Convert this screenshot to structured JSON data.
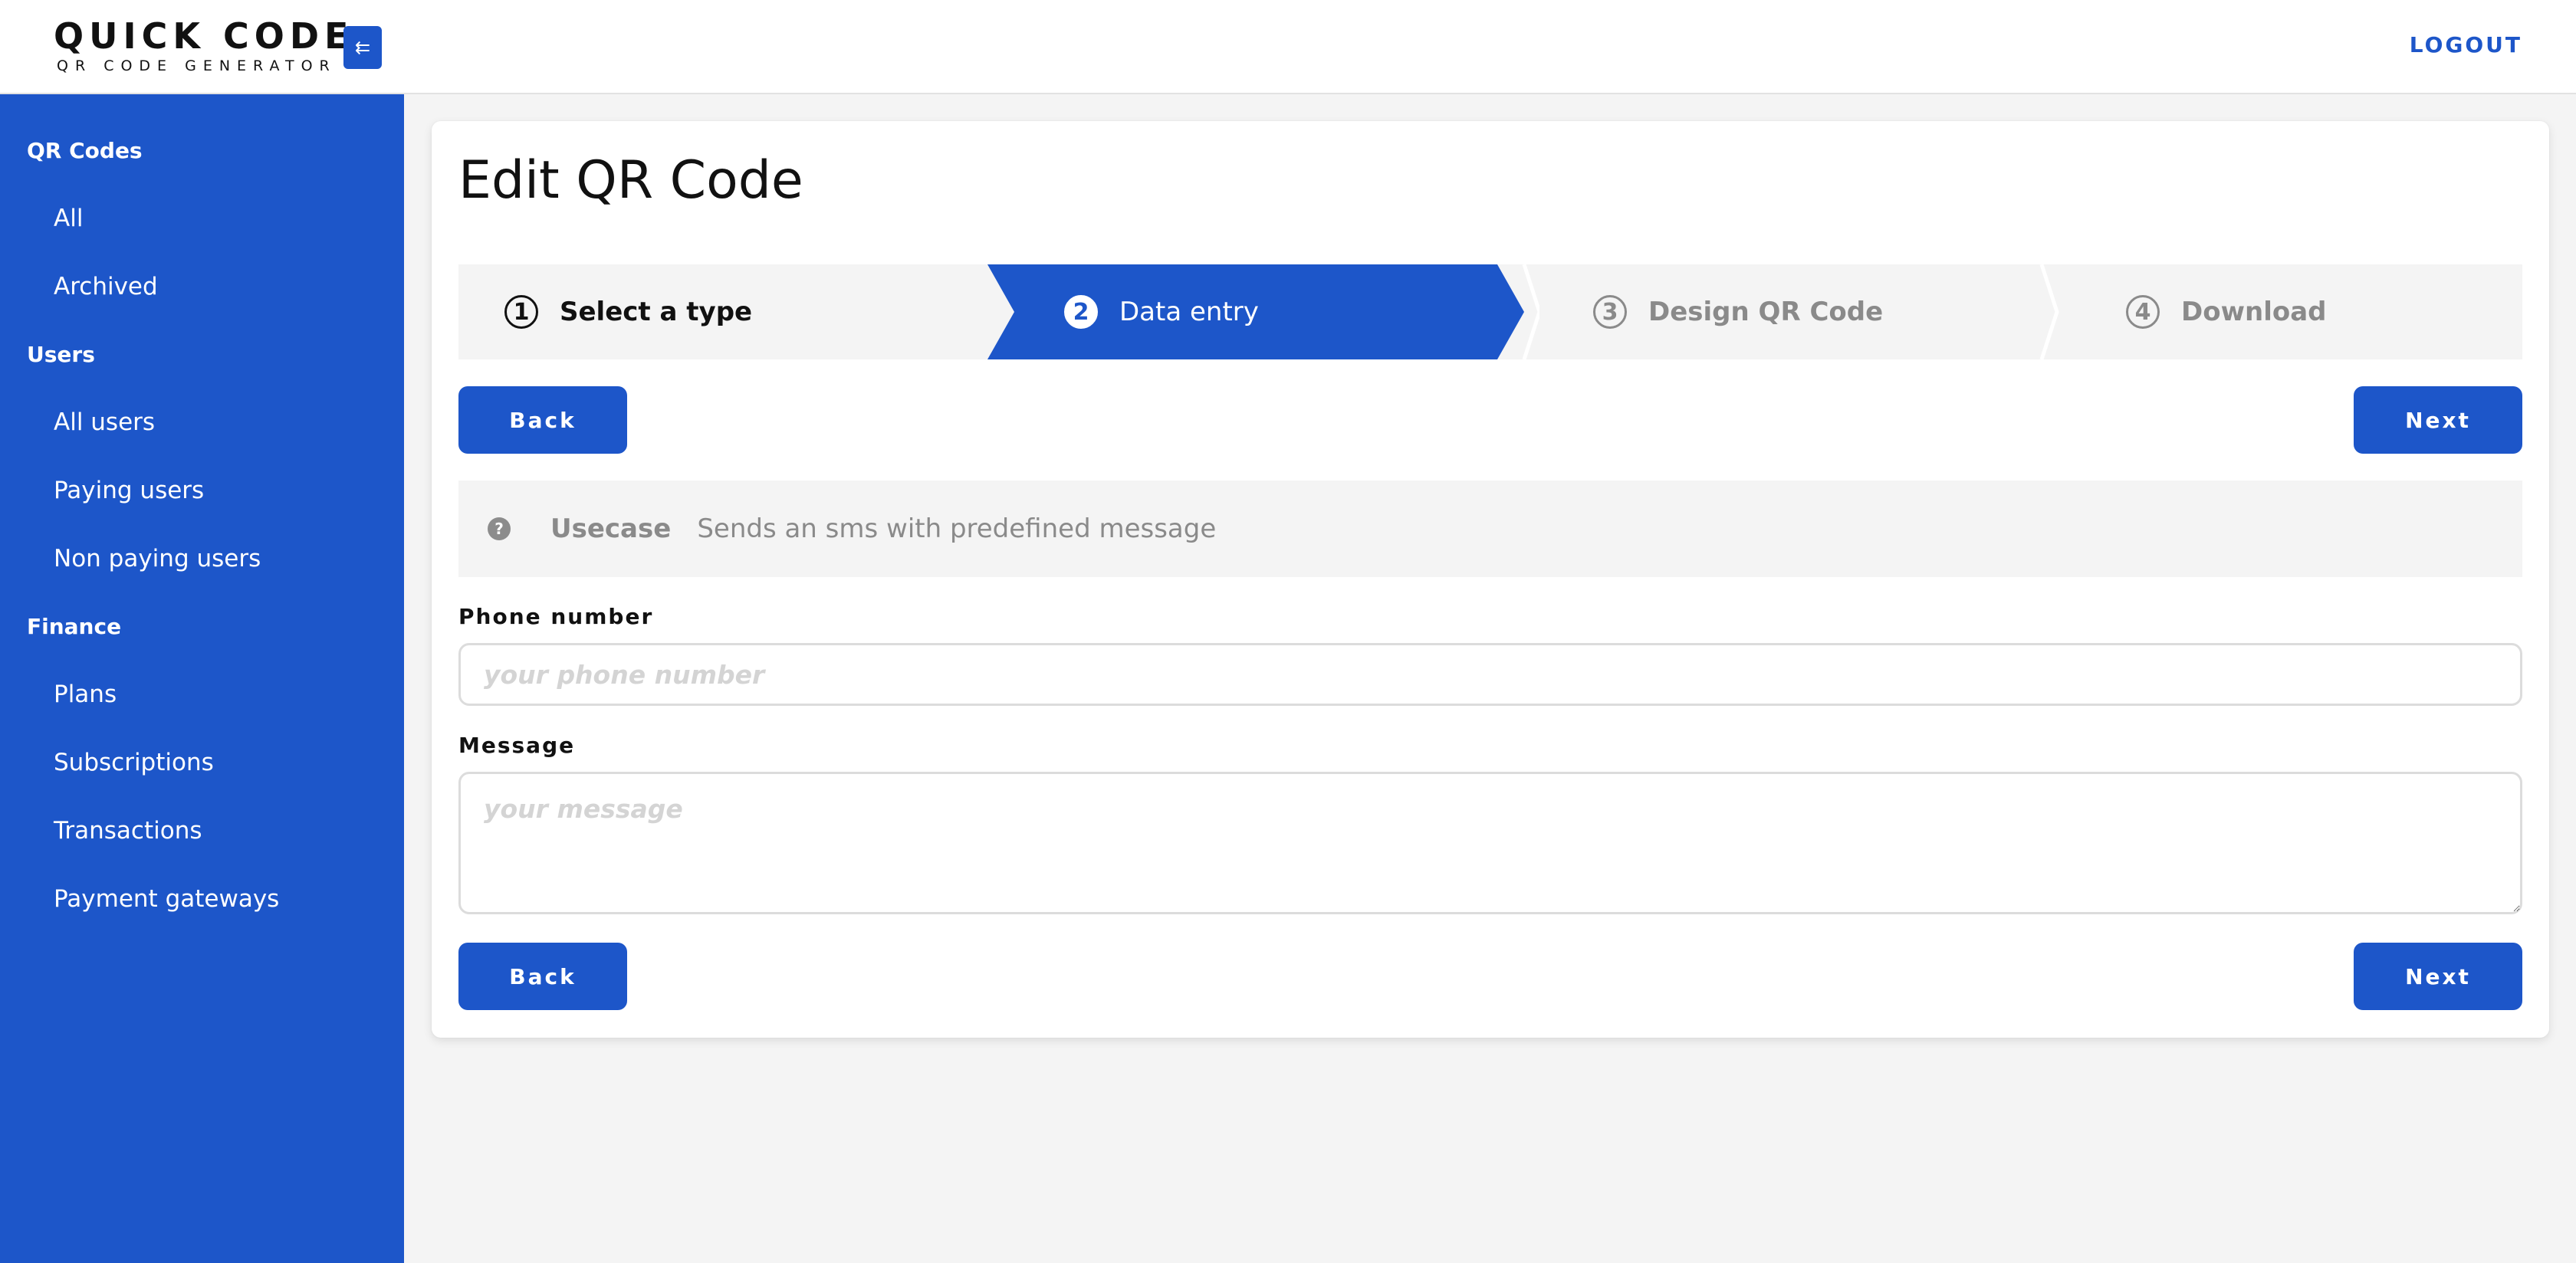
{
  "brand": {
    "title": "QUICK CODE",
    "subtitle": "QR CODE GENERATOR"
  },
  "header": {
    "logout_label": "LOGOUT",
    "collapse_icon": "collapse-sidebar-icon"
  },
  "sidebar": {
    "sections": [
      {
        "title": "QR Codes",
        "items": [
          "All",
          "Archived"
        ]
      },
      {
        "title": "Users",
        "items": [
          "All users",
          "Paying users",
          "Non paying users"
        ]
      },
      {
        "title": "Finance",
        "items": [
          "Plans",
          "Subscriptions",
          "Transactions",
          "Payment gateways"
        ]
      }
    ]
  },
  "page": {
    "title": "Edit QR Code"
  },
  "steps": [
    {
      "num": "1",
      "label": "Select a type",
      "state": "done"
    },
    {
      "num": "2",
      "label": "Data entry",
      "state": "active"
    },
    {
      "num": "3",
      "label": "Design QR Code",
      "state": "pending"
    },
    {
      "num": "4",
      "label": "Download",
      "state": "pending"
    }
  ],
  "buttons": {
    "back": "Back",
    "next": "Next"
  },
  "usecase": {
    "label": "Usecase",
    "text": "Sends an sms with predefined message"
  },
  "form": {
    "phone": {
      "label": "Phone number",
      "placeholder": "your phone number",
      "value": ""
    },
    "message": {
      "label": "Message",
      "placeholder": "your message",
      "value": ""
    }
  },
  "colors": {
    "accent": "#1d56c9",
    "muted": "#8a8a8a",
    "panel": "#f4f4f4"
  }
}
